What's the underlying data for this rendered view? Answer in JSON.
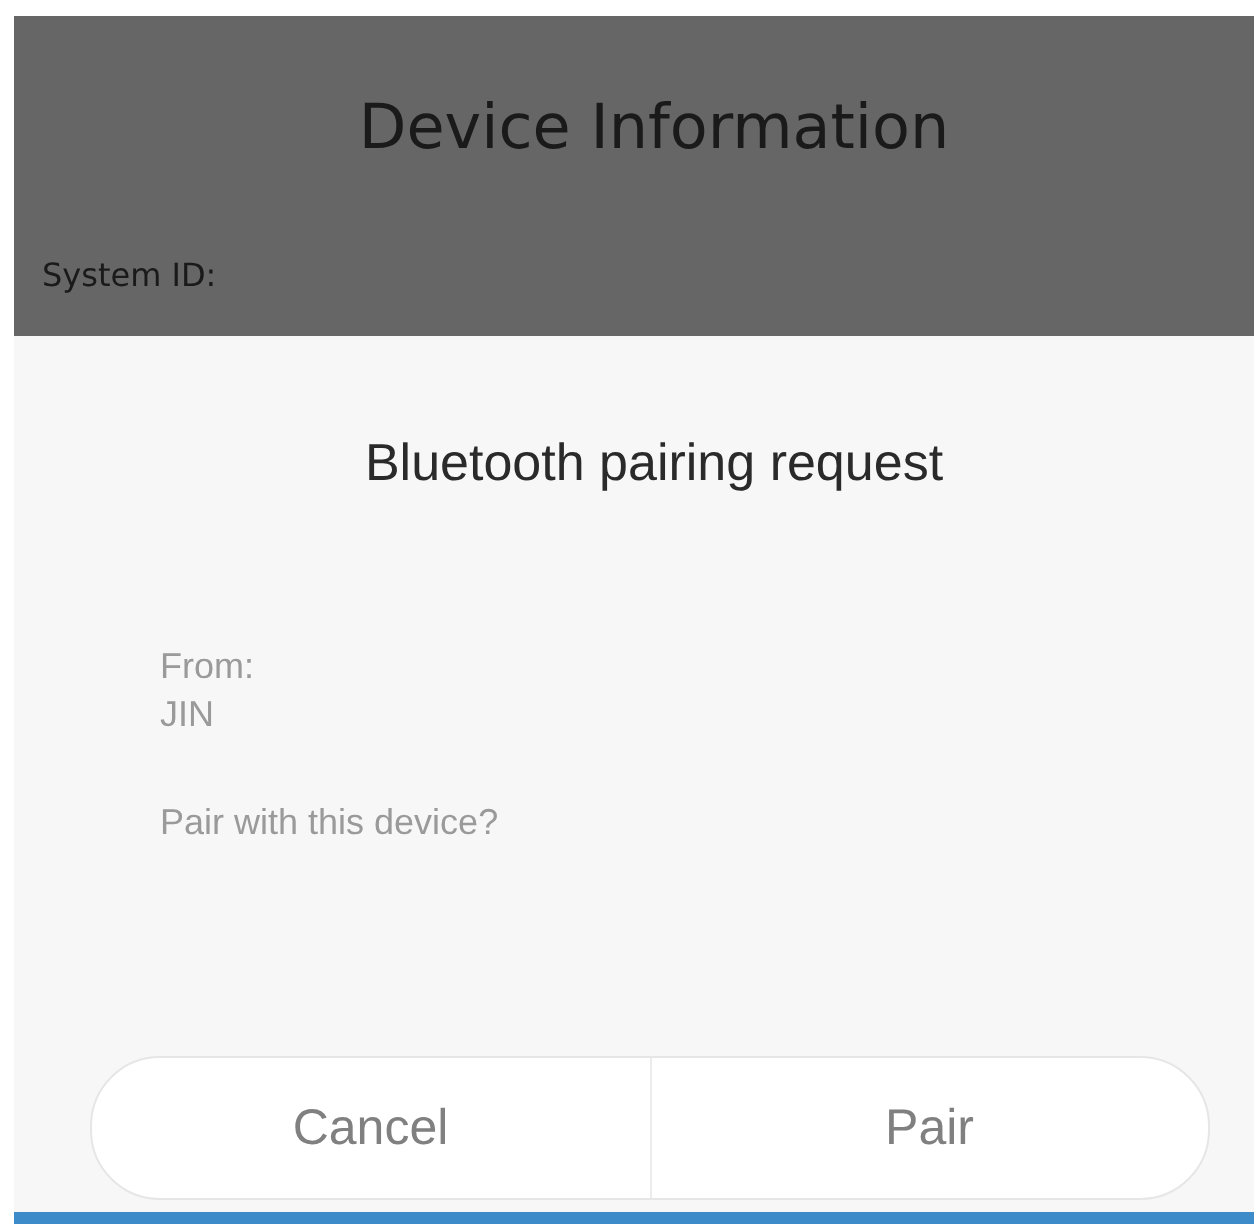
{
  "background_screen": {
    "title": "Device Information",
    "label": "System ID:"
  },
  "dialog": {
    "title": "Bluetooth pairing request",
    "lines": [
      {
        "kind": "label",
        "text": "From:"
      },
      {
        "kind": "value",
        "text": "JIN"
      },
      {
        "kind": "question",
        "text": "Pair with this device?"
      }
    ],
    "buttons": [
      "Cancel",
      "Pair"
    ]
  }
}
